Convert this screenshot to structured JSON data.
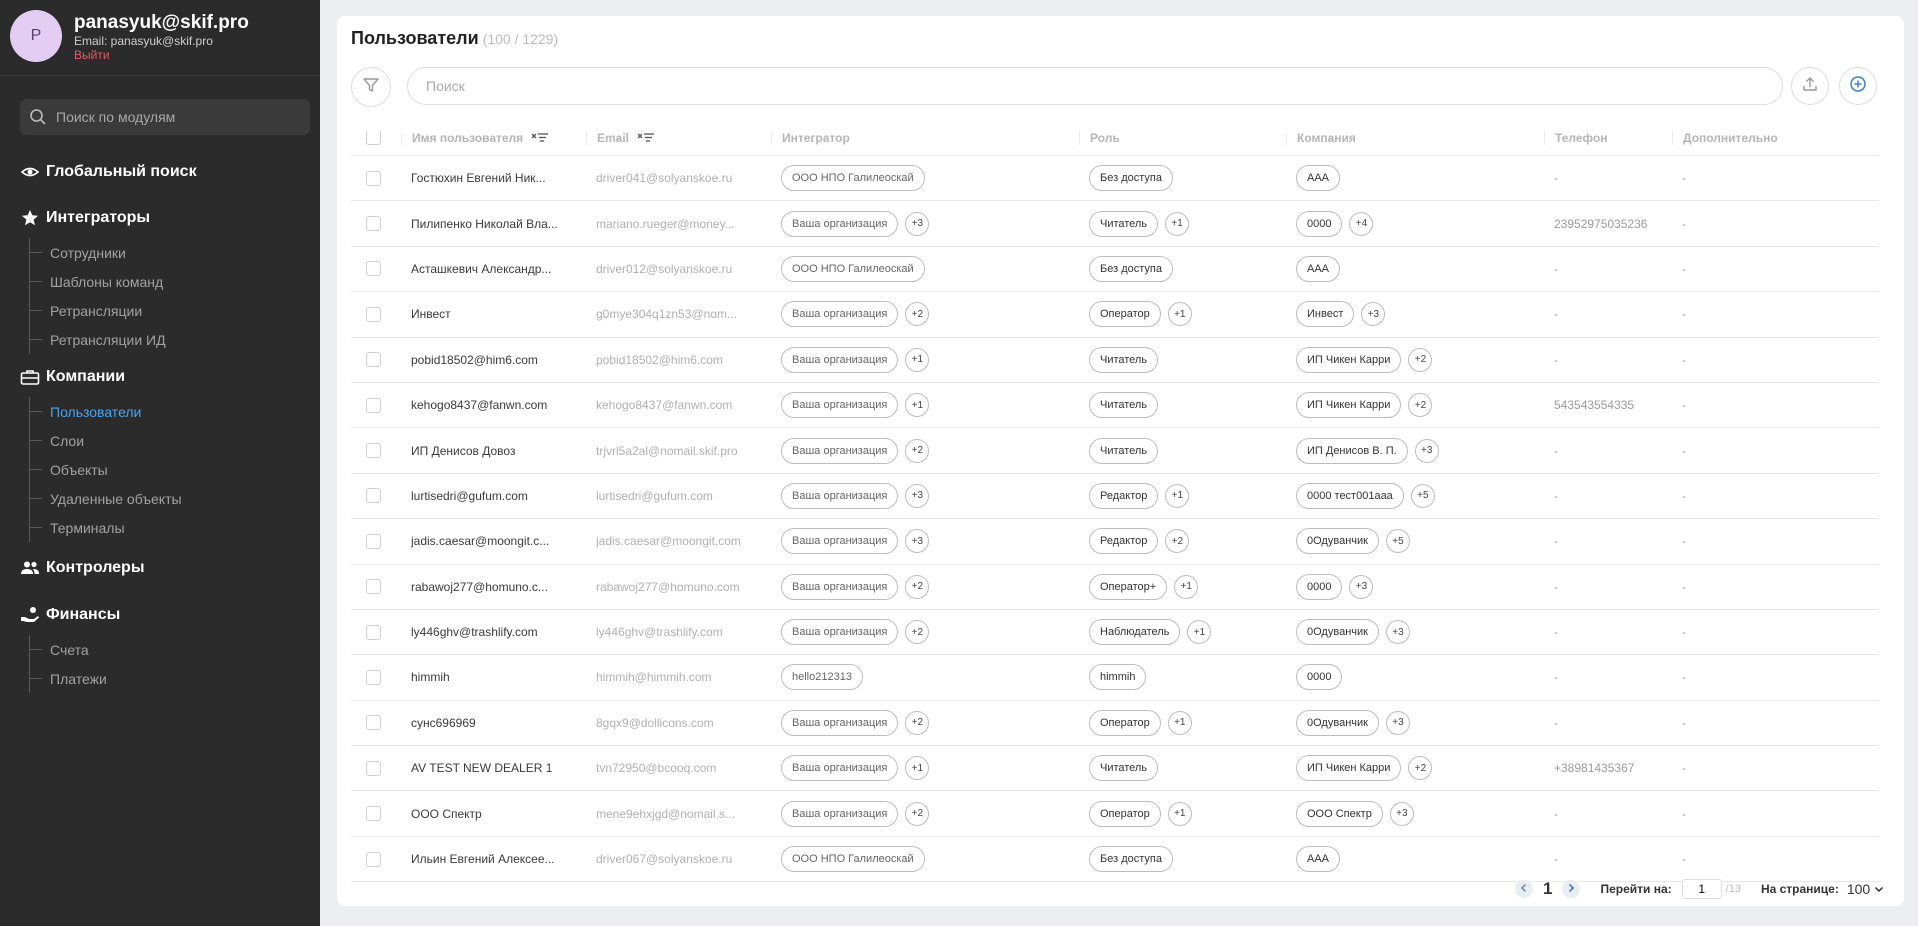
{
  "profile": {
    "initial": "P",
    "name": "panasyuk@skif.pro",
    "email_line": "Email: panasyuk@skif.pro",
    "logout": "Выйти"
  },
  "sidebar": {
    "search_placeholder": "Поиск по модулям",
    "global_search": "Глобальный поиск",
    "groups": [
      {
        "label": "Интеграторы",
        "icon": "star-icon",
        "items": [
          "Сотрудники",
          "Шаблоны команд",
          "Ретрансляции",
          "Ретрансляции ИД"
        ]
      },
      {
        "label": "Компании",
        "icon": "briefcase-icon",
        "items": [
          "Пользователи",
          "Слои",
          "Объекты",
          "Удаленные объекты",
          "Терминалы"
        ],
        "active": "Пользователи"
      },
      {
        "label": "Контролеры",
        "icon": "users-icon",
        "items": []
      },
      {
        "label": "Финансы",
        "icon": "hand-coin-icon",
        "items": [
          "Счета",
          "Платежи"
        ]
      }
    ]
  },
  "main": {
    "title": "Пользователи",
    "count": "(100 / 1229)",
    "search_placeholder": "Поиск",
    "columns": [
      "Имя пользователя",
      "Email",
      "Интегратор",
      "Роль",
      "Компания",
      "Телефон",
      "Дополнительно"
    ],
    "rows": [
      {
        "name": "Гостюхин Евгений Ник...",
        "email": "driver041@solyanskoe.ru",
        "integrator": "ООО НПО Галилеоскай",
        "integrator_more": "",
        "role": "Без доступа",
        "role_more": "",
        "company": "ААА",
        "company_more": "",
        "phone": "-",
        "extra": "-"
      },
      {
        "name": "Пилипенко Николай Вла...",
        "email": "mariano.rueger@money...",
        "integrator": "Ваша организация",
        "integrator_more": "+3",
        "role": "Читатель",
        "role_more": "+1",
        "company": "0000",
        "company_more": "+4",
        "phone": "23952975035236",
        "extra": "-"
      },
      {
        "name": "Асташкевич Александр...",
        "email": "driver012@solyanskoe.ru",
        "integrator": "ООО НПО Галилеоскай",
        "integrator_more": "",
        "role": "Без доступа",
        "role_more": "",
        "company": "ААА",
        "company_more": "",
        "phone": "-",
        "extra": "-"
      },
      {
        "name": "Инвест",
        "email": "g0mye304q1zn53@nom...",
        "integrator": "Ваша организация",
        "integrator_more": "+2",
        "role": "Оператор",
        "role_more": "+1",
        "company": "Инвест",
        "company_more": "+3",
        "phone": "-",
        "extra": "-"
      },
      {
        "name": "pobid18502@him6.com",
        "email": "pobid18502@him6.com",
        "integrator": "Ваша организация",
        "integrator_more": "+1",
        "role": "Читатель",
        "role_more": "",
        "company": "ИП Чикен Карри",
        "company_more": "+2",
        "phone": "-",
        "extra": "-"
      },
      {
        "name": "kehogo8437@fanwn.com",
        "email": "kehogo8437@fanwn.com",
        "integrator": "Ваша организация",
        "integrator_more": "+1",
        "role": "Читатель",
        "role_more": "",
        "company": "ИП Чикен Карри",
        "company_more": "+2",
        "phone": "543543554335",
        "extra": "-"
      },
      {
        "name": "ИП Денисов Довоз",
        "email": "trjvrl5a2al@nomail.skif.pro",
        "integrator": "Ваша организация",
        "integrator_more": "+2",
        "role": "Читатель",
        "role_more": "",
        "company": "ИП Денисов В. П.",
        "company_more": "+3",
        "phone": "-",
        "extra": "-"
      },
      {
        "name": "lurtisedri@gufum.com",
        "email": "lurtisedri@gufum.com",
        "integrator": "Ваша организация",
        "integrator_more": "+3",
        "role": "Редактор",
        "role_more": "+1",
        "company": "0000 тест001ааа",
        "company_more": "+5",
        "phone": "-",
        "extra": "-"
      },
      {
        "name": "jadis.caesar@moongit.c...",
        "email": "jadis.caesar@moongit.com",
        "integrator": "Ваша организация",
        "integrator_more": "+3",
        "role": "Редактор",
        "role_more": "+2",
        "company": "0Одуванчик",
        "company_more": "+5",
        "phone": "-",
        "extra": "-"
      },
      {
        "name": "rabawoj277@homuno.c...",
        "email": "rabawoj277@homuno.com",
        "integrator": "Ваша организация",
        "integrator_more": "+2",
        "role": "Оператор+",
        "role_more": "+1",
        "company": "0000",
        "company_more": "+3",
        "phone": "-",
        "extra": "-"
      },
      {
        "name": "ly446ghv@trashlify.com",
        "email": "ly446ghv@trashlify.com",
        "integrator": "Ваша организация",
        "integrator_more": "+2",
        "role": "Наблюдатель",
        "role_more": "+1",
        "company": "0Одуванчик",
        "company_more": "+3",
        "phone": "-",
        "extra": "-"
      },
      {
        "name": "himmih",
        "email": "himmih@himmih.com",
        "integrator": "hello212313",
        "integrator_more": "",
        "role": "himmih",
        "role_more": "",
        "company": "0000",
        "company_more": "",
        "phone": "-",
        "extra": "-"
      },
      {
        "name": "сунс696969",
        "email": "8gqx9@dollicons.com",
        "integrator": "Ваша организация",
        "integrator_more": "+2",
        "role": "Оператор",
        "role_more": "+1",
        "company": "0Одуванчик",
        "company_more": "+3",
        "phone": "-",
        "extra": "-"
      },
      {
        "name": "AV TEST NEW DEALER 1",
        "email": "tvn72950@bcooq.com",
        "integrator": "Ваша организация",
        "integrator_more": "+1",
        "role": "Читатель",
        "role_more": "",
        "company": "ИП Чикен Карри",
        "company_more": "+2",
        "phone": "+38981435367",
        "extra": "-"
      },
      {
        "name": "ООО Спектр",
        "email": "mene9ehxjgd@nomail.s...",
        "integrator": "Ваша организация",
        "integrator_more": "+2",
        "role": "Оператор",
        "role_more": "+1",
        "company": "ООО Спектр",
        "company_more": "+3",
        "phone": "-",
        "extra": "-"
      },
      {
        "name": "Ильин Евгений Алексее...",
        "email": "driver067@solyanskoe.ru",
        "integrator": "ООО НПО Галилеоскай",
        "integrator_more": "",
        "role": "Без доступа",
        "role_more": "",
        "company": "ААА",
        "company_more": "",
        "phone": "-",
        "extra": "-"
      }
    ]
  },
  "pagination": {
    "current": "1",
    "goto_label": "Перейти на:",
    "goto_value": "1",
    "total": "/13",
    "per_page_label": "На странице:",
    "per_page": "100"
  }
}
